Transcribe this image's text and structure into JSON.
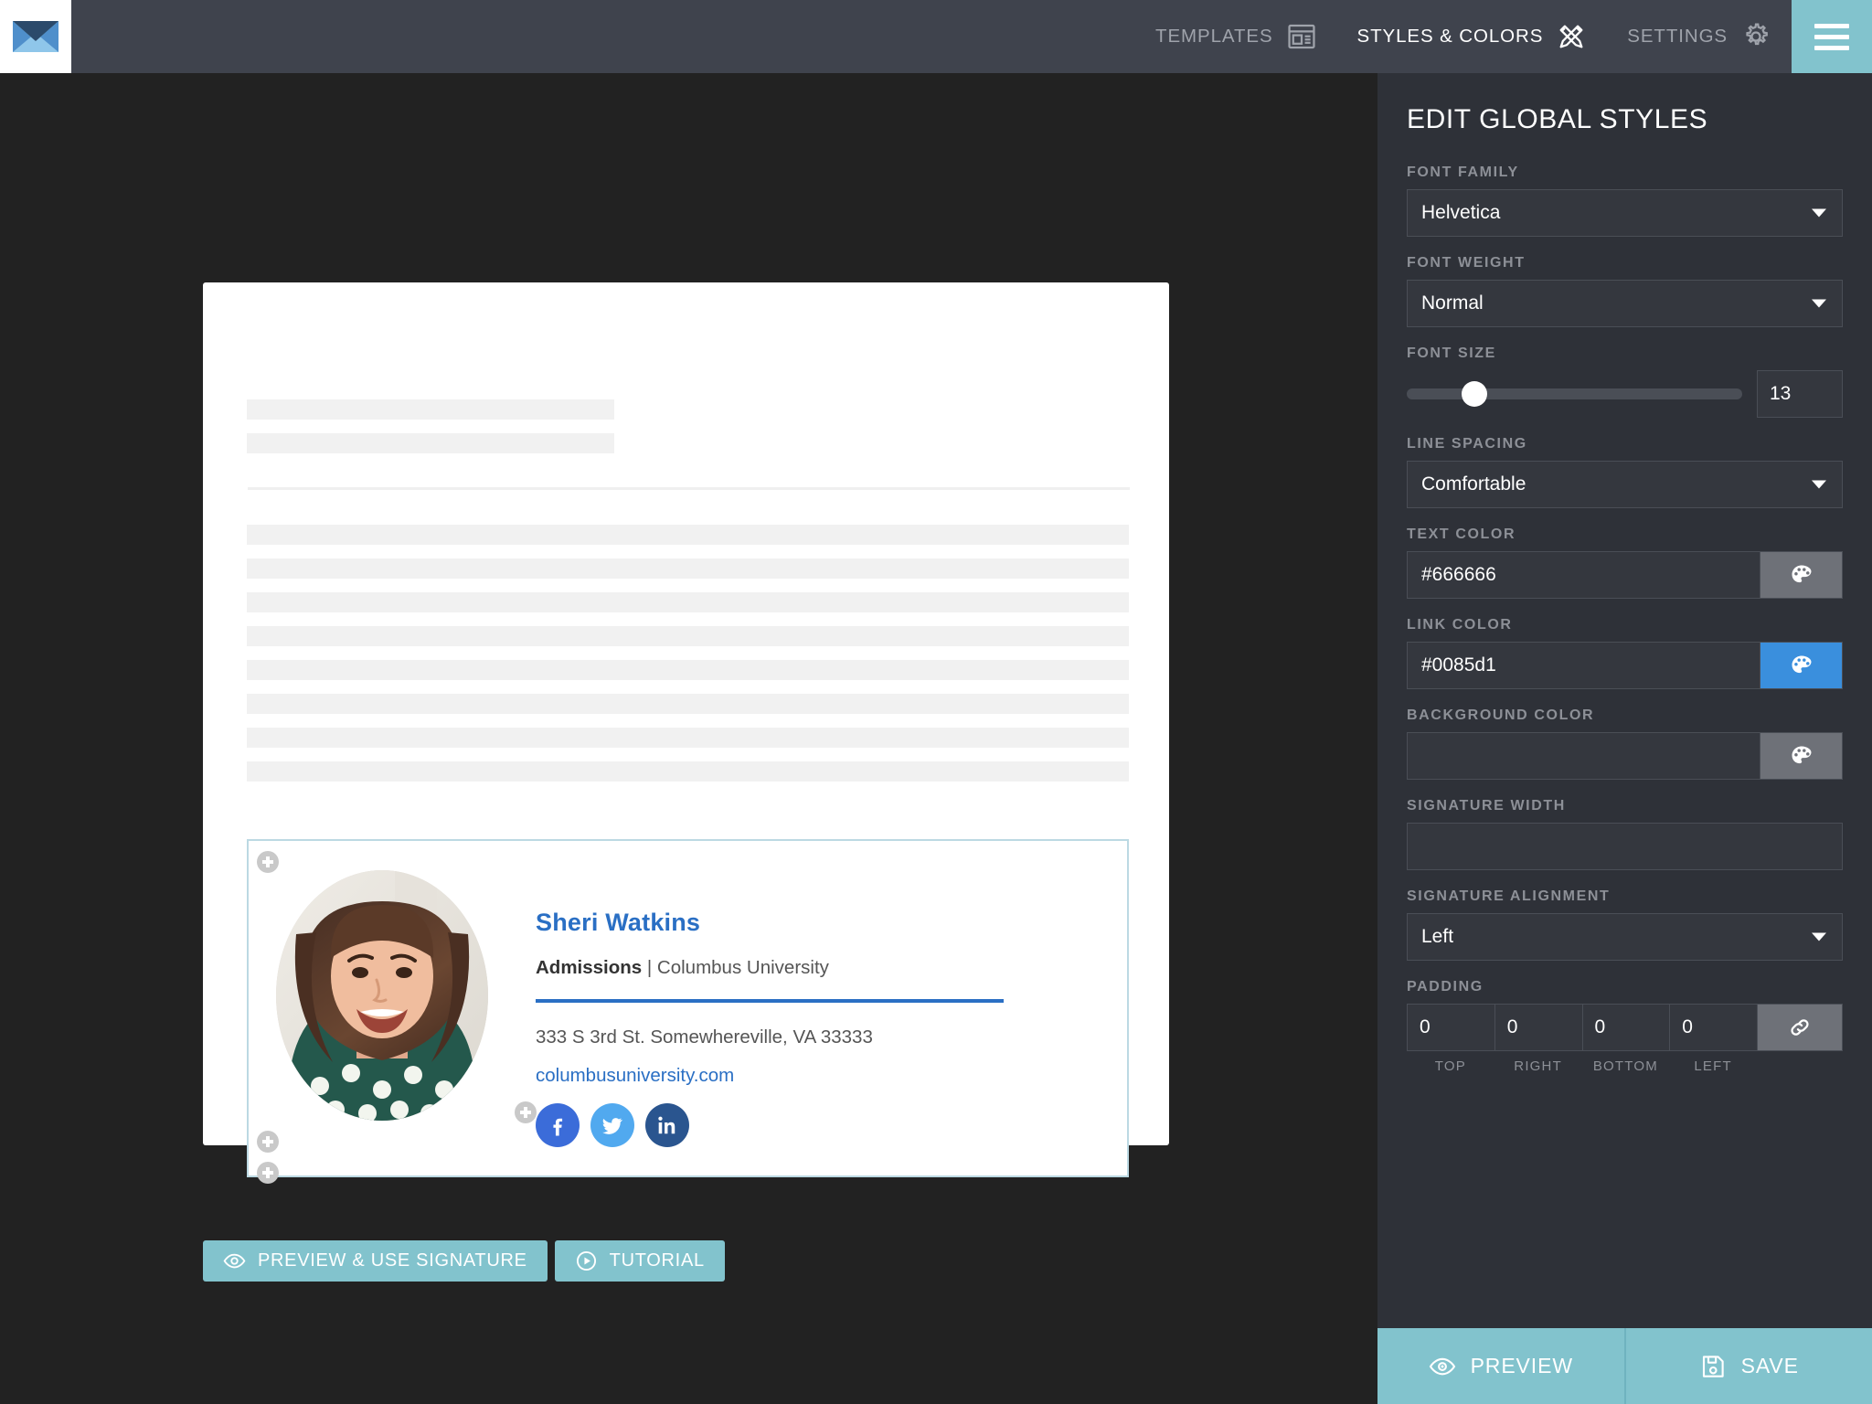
{
  "header": {
    "logo_icon": "envelope-icon",
    "nav": [
      {
        "label": "TEMPLATES",
        "icon": "templates-icon",
        "active": false
      },
      {
        "label": "STYLES & COLORS",
        "icon": "pencil-ruler-icon",
        "active": true
      },
      {
        "label": "SETTINGS",
        "icon": "gear-icon",
        "active": false
      }
    ],
    "menu_icon": "hamburger-menu-icon"
  },
  "canvas": {
    "document": {
      "top_placeholder_lines": 2,
      "body_placeholder_lines": 8,
      "divider": true
    },
    "signature": {
      "name": "Sheri Watkins",
      "title_bold": "Admissions",
      "title_separator": " | ",
      "title_rest": "Columbus University",
      "address": "333 S 3rd St. Somewhereville, VA 33333",
      "website": "columbusuniversity.com",
      "avatar_alt": "portrait-photo",
      "socials": [
        {
          "name": "facebook-icon",
          "color": "#3b6cd9"
        },
        {
          "name": "twitter-icon",
          "color": "#51a9ef"
        },
        {
          "name": "linkedin-icon",
          "color": "#2a558f"
        }
      ],
      "add_handles": 4
    },
    "actions": [
      {
        "label": "PREVIEW & USE SIGNATURE",
        "icon": "eye-icon"
      },
      {
        "label": "TUTORIAL",
        "icon": "play-circle-icon"
      }
    ]
  },
  "panel": {
    "title": "EDIT GLOBAL STYLES",
    "font_family": {
      "label": "FONT FAMILY",
      "value": "Helvetica"
    },
    "font_weight": {
      "label": "FONT WEIGHT",
      "value": "Normal"
    },
    "font_size": {
      "label": "FONT SIZE",
      "value": "13",
      "slider_percent": 20
    },
    "line_spacing": {
      "label": "LINE SPACING",
      "value": "Comfortable"
    },
    "text_color": {
      "label": "TEXT COLOR",
      "value": "#666666",
      "swatch": "#6e7178",
      "icon": "palette-icon"
    },
    "link_color": {
      "label": "LINK COLOR",
      "value": "#0085d1",
      "swatch": "#3a8fdd",
      "icon": "palette-icon"
    },
    "background_color": {
      "label": "BACKGROUND COLOR",
      "value": "",
      "swatch": "#6e7178",
      "icon": "palette-icon"
    },
    "signature_width": {
      "label": "SIGNATURE WIDTH",
      "value": ""
    },
    "signature_alignment": {
      "label": "SIGNATURE ALIGNMENT",
      "value": "Left"
    },
    "padding": {
      "label": "PADDING",
      "values": [
        "0",
        "0",
        "0",
        "0"
      ],
      "sub_labels": [
        "TOP",
        "RIGHT",
        "BOTTOM",
        "LEFT"
      ],
      "link_icon": "link-chain-icon"
    },
    "footer": [
      {
        "label": "PREVIEW",
        "icon": "eye-icon"
      },
      {
        "label": "SAVE",
        "icon": "floppy-disk-icon"
      }
    ]
  },
  "colors": {
    "topbar": "#3f434d",
    "accent": "#82c3cd",
    "panel_bg": "#2e3138",
    "canvas_bg": "#222222",
    "link_blue": "#2a6fc4"
  }
}
